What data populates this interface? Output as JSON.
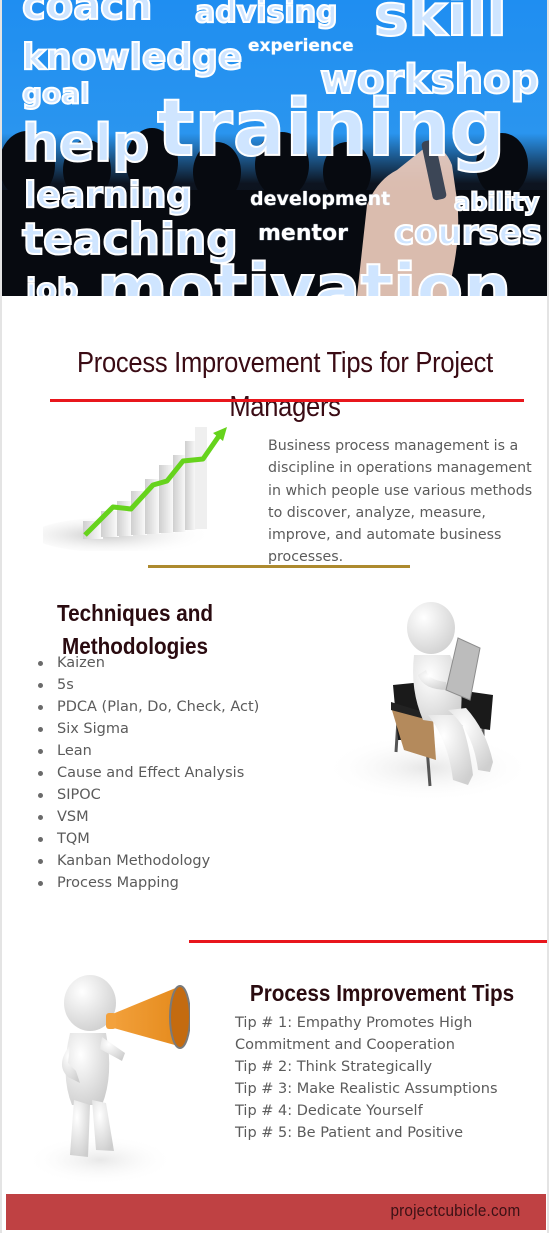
{
  "hero": {
    "image_alt": "Word cloud on chalkboard with hand writing",
    "words": [
      "coach",
      "advising",
      "skill",
      "knowledge",
      "experience",
      "workshop",
      "goal",
      "help",
      "training",
      "learning",
      "development",
      "ability",
      "teaching",
      "mentor",
      "courses",
      "job",
      "motivation"
    ],
    "colors": {
      "sky": "#1f8ef1",
      "silhouettes": "#05070b"
    }
  },
  "header": {
    "title": "Process Improvement Tips for Project Managers"
  },
  "intro": {
    "image_alt": "Rising bar chart with green arrow",
    "text": "Business process management is a discipline in operations management in which people use various methods to discover, analyze, measure, improve, and automate business processes."
  },
  "techniques": {
    "heading_line1": "Techniques and",
    "heading_line2": "Methodologies",
    "items": [
      "Kaizen",
      "5s",
      "PDCA (Plan, Do, Check, Act)",
      "Six Sigma",
      "Lean",
      "Cause and Effect Analysis",
      "SIPOC",
      "VSM",
      "TQM",
      "Kanban Methodology",
      "Process Mapping"
    ],
    "image_alt": "3D figure sitting in chair reading newspaper"
  },
  "tips": {
    "heading": "Process Improvement Tips",
    "items": [
      "Tip # 1: Empathy Promotes High Commitment and Cooperation",
      "Tip # 2: Think Strategically",
      "Tip # 3: Make Realistic Assumptions",
      "Tip # 4: Dedicate Yourself",
      "Tip # 5: Be Patient and Positive"
    ],
    "image_alt": "3D figure shouting into orange megaphone"
  },
  "footer": {
    "site": "projectcubicle.com"
  },
  "colors": {
    "accent_red": "#e8161c",
    "accent_gold": "#ad8a2f",
    "footer_bg": "#bf4143",
    "heading_text": "#3a0b14",
    "body_text": "#5b5b5b"
  }
}
